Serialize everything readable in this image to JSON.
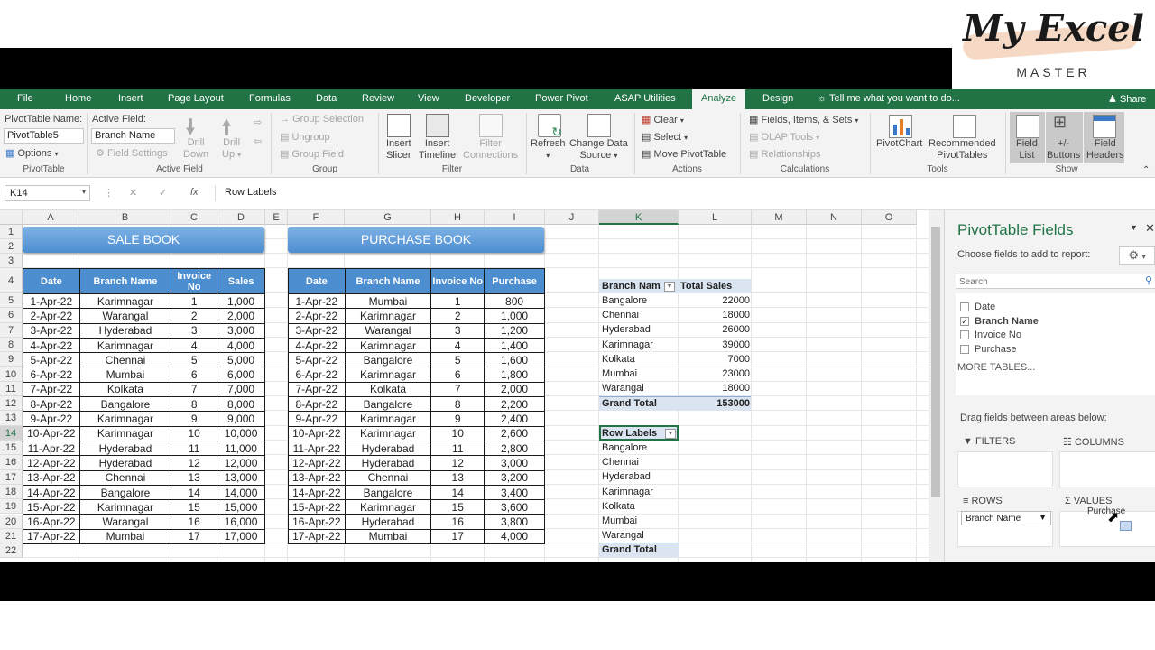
{
  "logo": {
    "script": "My Excel",
    "sub": "MASTER"
  },
  "tabs": [
    "File",
    "Home",
    "Insert",
    "Page Layout",
    "Formulas",
    "Data",
    "Review",
    "View",
    "Developer",
    "Power Pivot",
    "ASAP Utilities",
    "Analyze",
    "Design"
  ],
  "tell_me": "Tell me what you want to do...",
  "share": "Share",
  "ribbon": {
    "pivot_name_label": "PivotTable Name:",
    "pivot_name_value": "PivotTable5",
    "options": "Options",
    "active_field_label": "Active Field:",
    "active_field_value": "Branch Name",
    "field_settings": "Field Settings",
    "drill_down": [
      "Drill",
      "Down"
    ],
    "drill_up": [
      "Drill",
      "Up"
    ],
    "group_selection": "Group Selection",
    "ungroup": "Ungroup",
    "group_field": "Group Field",
    "insert_slicer": [
      "Insert",
      "Slicer"
    ],
    "insert_timeline": [
      "Insert",
      "Timeline"
    ],
    "filter_connections": [
      "Filter",
      "Connections"
    ],
    "refresh": "Refresh",
    "change_data_source": [
      "Change Data",
      "Source"
    ],
    "clear": "Clear",
    "select": "Select",
    "move_pivot": "Move PivotTable",
    "fields_items_sets": "Fields, Items, & Sets",
    "olap_tools": "OLAP Tools",
    "relationships": "Relationships",
    "pivotchart": "PivotChart",
    "recommended": [
      "Recommended",
      "PivotTables"
    ],
    "field_list": [
      "Field",
      "List"
    ],
    "plus_minus": [
      "+/-",
      "Buttons"
    ],
    "field_headers": [
      "Field",
      "Headers"
    ],
    "groups": {
      "pivottable": "PivotTable",
      "active_field": "Active Field",
      "group": "Group",
      "filter": "Filter",
      "data": "Data",
      "actions": "Actions",
      "calculations": "Calculations",
      "tools": "Tools",
      "show": "Show"
    }
  },
  "formula_bar": {
    "name_box": "K14",
    "fx": "fx",
    "content": "Row Labels"
  },
  "columns": [
    "A",
    "B",
    "C",
    "D",
    "E",
    "F",
    "G",
    "H",
    "I",
    "J",
    "K",
    "L",
    "M",
    "N",
    "O"
  ],
  "rows": [
    "1",
    "2",
    "3",
    "4",
    "5",
    "6",
    "7",
    "8",
    "9",
    "10",
    "11",
    "12",
    "13",
    "14",
    "15",
    "16",
    "17",
    "18",
    "19",
    "20",
    "21",
    "22"
  ],
  "sale_book": {
    "title": "SALE BOOK",
    "headers": [
      "Date",
      "Branch Name",
      "Invoice No",
      "Sales"
    ],
    "rows": [
      [
        "1-Apr-22",
        "Karimnagar",
        "1",
        "1,000"
      ],
      [
        "2-Apr-22",
        "Warangal",
        "2",
        "2,000"
      ],
      [
        "3-Apr-22",
        "Hyderabad",
        "3",
        "3,000"
      ],
      [
        "4-Apr-22",
        "Karimnagar",
        "4",
        "4,000"
      ],
      [
        "5-Apr-22",
        "Chennai",
        "5",
        "5,000"
      ],
      [
        "6-Apr-22",
        "Mumbai",
        "6",
        "6,000"
      ],
      [
        "7-Apr-22",
        "Kolkata",
        "7",
        "7,000"
      ],
      [
        "8-Apr-22",
        "Bangalore",
        "8",
        "8,000"
      ],
      [
        "9-Apr-22",
        "Karimnagar",
        "9",
        "9,000"
      ],
      [
        "10-Apr-22",
        "Karimnagar",
        "10",
        "10,000"
      ],
      [
        "11-Apr-22",
        "Hyderabad",
        "11",
        "11,000"
      ],
      [
        "12-Apr-22",
        "Hyderabad",
        "12",
        "12,000"
      ],
      [
        "13-Apr-22",
        "Chennai",
        "13",
        "13,000"
      ],
      [
        "14-Apr-22",
        "Bangalore",
        "14",
        "14,000"
      ],
      [
        "15-Apr-22",
        "Karimnagar",
        "15",
        "15,000"
      ],
      [
        "16-Apr-22",
        "Warangal",
        "16",
        "16,000"
      ],
      [
        "17-Apr-22",
        "Mumbai",
        "17",
        "17,000"
      ]
    ]
  },
  "purchase_book": {
    "title": "PURCHASE BOOK",
    "headers": [
      "Date",
      "Branch Name",
      "Invoice No",
      "Purchase"
    ],
    "rows": [
      [
        "1-Apr-22",
        "Mumbai",
        "1",
        "800"
      ],
      [
        "2-Apr-22",
        "Karimnagar",
        "2",
        "1,000"
      ],
      [
        "3-Apr-22",
        "Warangal",
        "3",
        "1,200"
      ],
      [
        "4-Apr-22",
        "Karimnagar",
        "4",
        "1,400"
      ],
      [
        "5-Apr-22",
        "Bangalore",
        "5",
        "1,600"
      ],
      [
        "6-Apr-22",
        "Karimnagar",
        "6",
        "1,800"
      ],
      [
        "7-Apr-22",
        "Kolkata",
        "7",
        "2,000"
      ],
      [
        "8-Apr-22",
        "Bangalore",
        "8",
        "2,200"
      ],
      [
        "9-Apr-22",
        "Karimnagar",
        "9",
        "2,400"
      ],
      [
        "10-Apr-22",
        "Karimnagar",
        "10",
        "2,600"
      ],
      [
        "11-Apr-22",
        "Hyderabad",
        "11",
        "2,800"
      ],
      [
        "12-Apr-22",
        "Hyderabad",
        "12",
        "3,000"
      ],
      [
        "13-Apr-22",
        "Chennai",
        "13",
        "3,200"
      ],
      [
        "14-Apr-22",
        "Bangalore",
        "14",
        "3,400"
      ],
      [
        "15-Apr-22",
        "Karimnagar",
        "15",
        "3,600"
      ],
      [
        "16-Apr-22",
        "Hyderabad",
        "16",
        "3,800"
      ],
      [
        "17-Apr-22",
        "Mumbai",
        "17",
        "4,000"
      ]
    ]
  },
  "pivot1": {
    "header_label": "Branch Nam",
    "header_value": "Total Sales",
    "rows": [
      [
        "Bangalore",
        "22000"
      ],
      [
        "Chennai",
        "18000"
      ],
      [
        "Hyderabad",
        "26000"
      ],
      [
        "Karimnagar",
        "39000"
      ],
      [
        "Kolkata",
        "7000"
      ],
      [
        "Mumbai",
        "23000"
      ],
      [
        "Warangal",
        "18000"
      ]
    ],
    "grand_total_label": "Grand Total",
    "grand_total_value": "153000"
  },
  "pivot2": {
    "header_label": "Row Labels",
    "rows": [
      "Bangalore",
      "Chennai",
      "Hyderabad",
      "Karimnagar",
      "Kolkata",
      "Mumbai",
      "Warangal"
    ],
    "grand_total_label": "Grand Total"
  },
  "pane": {
    "title": "PivotTable Fields",
    "choose": "Choose fields to add to report:",
    "search_placeholder": "Search",
    "fields": [
      {
        "name": "Date",
        "checked": false
      },
      {
        "name": "Branch Name",
        "checked": true
      },
      {
        "name": "Invoice No",
        "checked": false
      },
      {
        "name": "Purchase",
        "checked": false
      }
    ],
    "more_tables": "MORE TABLES...",
    "drag_label": "Drag fields between areas below:",
    "filters": "FILTERS",
    "columns": "COLUMNS",
    "rows": "ROWS",
    "values": "VALUES",
    "rows_item": "Branch Name",
    "drag_item": "Purchase"
  }
}
